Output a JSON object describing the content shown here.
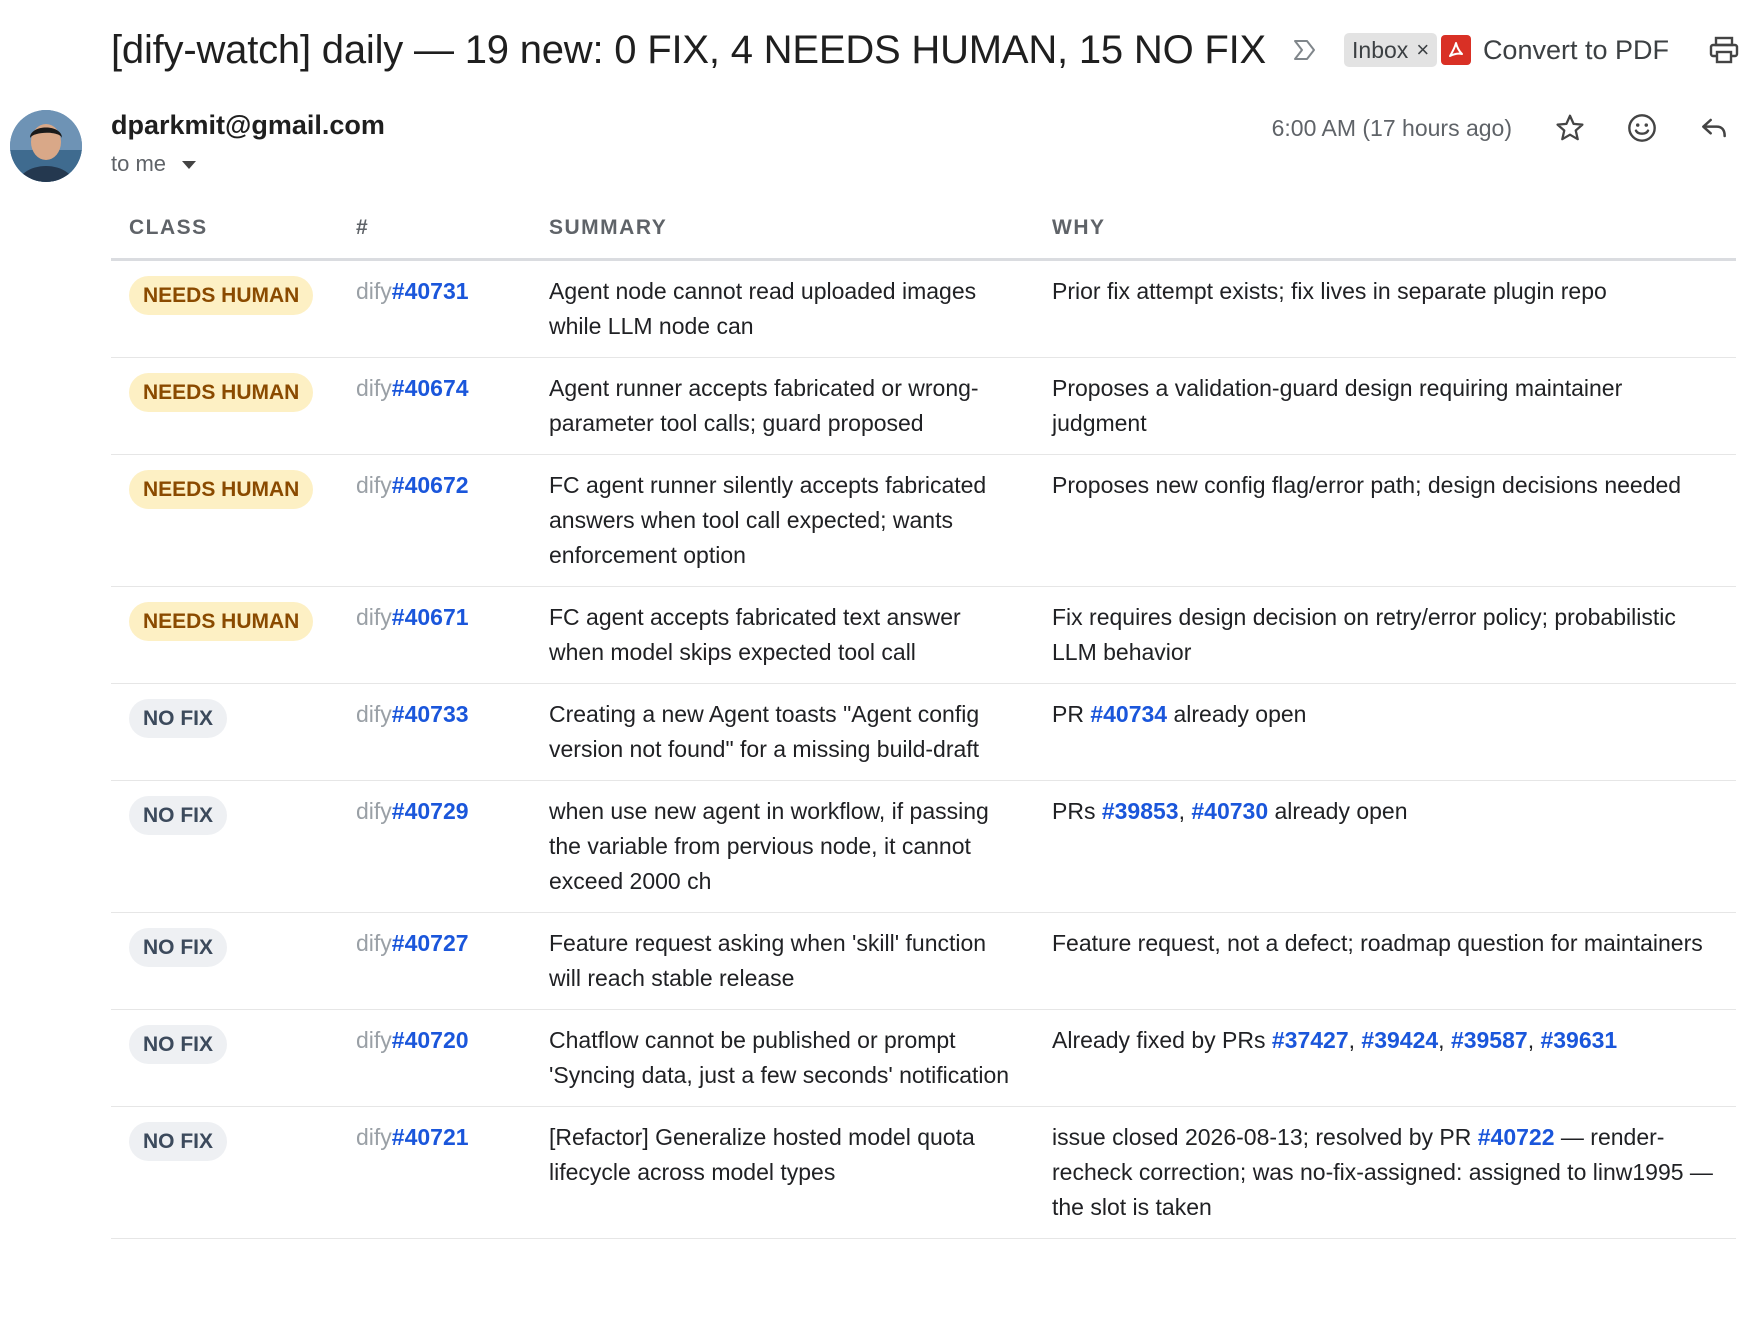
{
  "header": {
    "subject": "[dify-watch] daily — 19 new: 0 FIX, 4 NEEDS HUMAN, 15 NO FIX",
    "label": "Inbox",
    "label_remove": "×",
    "convert_label": "Convert to PDF"
  },
  "message": {
    "sender": "dparkmit@gmail.com",
    "to": "to me",
    "time": "6:00 AM (17 hours ago)"
  },
  "icons": {
    "important": "importance-marker-icon",
    "pdf": "pdf-icon",
    "print": "print-icon",
    "star": "star-icon",
    "emoji": "emoji-reaction-icon",
    "reply": "reply-icon",
    "caret": "chevron-down-icon"
  },
  "colors": {
    "needs_human_bg": "#fdf0c4",
    "needs_human_text": "#8a4a00",
    "no_fix_bg": "#eef0f3",
    "no_fix_text": "#3c4a5c",
    "link": "#1a56db"
  },
  "table": {
    "headers": [
      "CLASS",
      "#",
      "SUMMARY",
      "WHY"
    ],
    "rows": [
      {
        "cls": "NEEDS HUMAN",
        "kind": "nh",
        "repo": "dify",
        "num": "#40731",
        "summary": "Agent node cannot read uploaded images while LLM node can",
        "why": [
          {
            "t": "Prior fix attempt exists; fix lives in separate plugin repo"
          }
        ]
      },
      {
        "cls": "NEEDS HUMAN",
        "kind": "nh",
        "repo": "dify",
        "num": "#40674",
        "summary": "Agent runner accepts fabricated or wrong-parameter tool calls; guard proposed",
        "why": [
          {
            "t": "Proposes a validation-guard design requiring maintainer judgment"
          }
        ]
      },
      {
        "cls": "NEEDS HUMAN",
        "kind": "nh",
        "repo": "dify",
        "num": "#40672",
        "summary": "FC agent runner silently accepts fabricated answers when tool call expected; wants enforcement option",
        "why": [
          {
            "t": "Proposes new config flag/error path; design decisions needed"
          }
        ]
      },
      {
        "cls": "NEEDS HUMAN",
        "kind": "nh",
        "repo": "dify",
        "num": "#40671",
        "summary": "FC agent accepts fabricated text answer when model skips expected tool call",
        "why": [
          {
            "t": "Fix requires design decision on retry/error policy; probabilistic LLM behavior"
          }
        ]
      },
      {
        "cls": "NO FIX",
        "kind": "nf",
        "repo": "dify",
        "num": "#40733",
        "summary": "Creating a new Agent toasts \"Agent config version not found\" for a missing build-draft",
        "why": [
          {
            "t": "PR "
          },
          {
            "t": "#40734",
            "link": true
          },
          {
            "t": " already open"
          }
        ]
      },
      {
        "cls": "NO FIX",
        "kind": "nf",
        "repo": "dify",
        "num": "#40729",
        "summary": "when use new agent in workflow, if passing the variable from pervious node, it cannot exceed 2000 ch",
        "why": [
          {
            "t": "PRs "
          },
          {
            "t": "#39853",
            "link": true
          },
          {
            "t": ", "
          },
          {
            "t": "#40730",
            "link": true
          },
          {
            "t": " already open"
          }
        ]
      },
      {
        "cls": "NO FIX",
        "kind": "nf",
        "repo": "dify",
        "num": "#40727",
        "summary": "Feature request asking when 'skill' function will reach stable release",
        "why": [
          {
            "t": "Feature request, not a defect; roadmap question for maintainers"
          }
        ]
      },
      {
        "cls": "NO FIX",
        "kind": "nf",
        "repo": "dify",
        "num": "#40720",
        "summary": "Chatflow cannot be published or prompt 'Syncing data, just a few seconds' notification",
        "why": [
          {
            "t": "Already fixed by PRs "
          },
          {
            "t": "#37427",
            "link": true
          },
          {
            "t": ", "
          },
          {
            "t": "#39424",
            "link": true
          },
          {
            "t": ", "
          },
          {
            "t": "#39587",
            "link": true
          },
          {
            "t": ", "
          },
          {
            "t": "#39631",
            "link": true
          }
        ]
      },
      {
        "cls": "NO FIX",
        "kind": "nf",
        "repo": "dify",
        "num": "#40721",
        "summary": "[Refactor] Generalize hosted model quota lifecycle across model types",
        "why": [
          {
            "t": "issue closed 2026-08-13; resolved by PR "
          },
          {
            "t": "#40722",
            "link": true
          },
          {
            "t": " — render-recheck correction; was no-fix-assigned: assigned to linw1995 — the slot is taken"
          }
        ]
      }
    ]
  }
}
